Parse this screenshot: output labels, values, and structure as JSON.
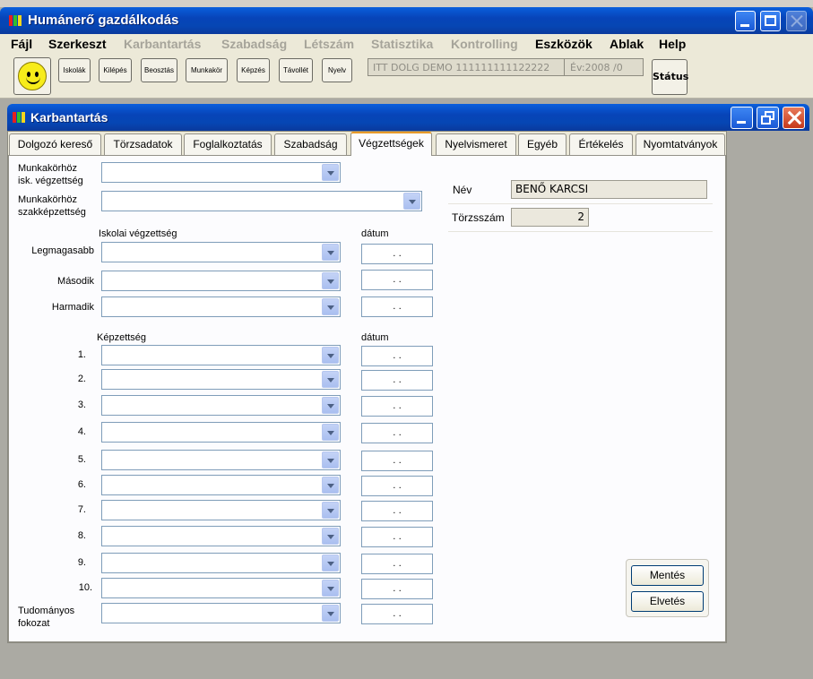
{
  "app": {
    "title": "Humánerő gazdálkodás",
    "menu": [
      {
        "label": "Fájl",
        "enabled": true
      },
      {
        "label": "Szerkeszt",
        "enabled": true
      },
      {
        "label": "Karbantartás",
        "enabled": false
      },
      {
        "label": "Szabadság",
        "enabled": false
      },
      {
        "label": "Létszám",
        "enabled": false
      },
      {
        "label": "Statisztika",
        "enabled": false
      },
      {
        "label": "Kontrolling",
        "enabled": false
      },
      {
        "label": "Eszközök",
        "enabled": true
      },
      {
        "label": "Ablak",
        "enabled": true
      },
      {
        "label": "Help",
        "enabled": true
      }
    ],
    "toolbar": {
      "buttons": [
        "Iskolák",
        "Kilépés",
        "Beosztás",
        "Munkakör",
        "Képzés",
        "Távollét",
        "Nyelv"
      ],
      "info_text": "ITT DOLG DEMO 111111111122222",
      "info_year": "Év:2008  /0",
      "status_label": "Státus"
    }
  },
  "child": {
    "title": "Karbantartás",
    "tabs": [
      "Dolgozó kereső",
      "Törzsadatok",
      "Foglalkoztatás",
      "Szabadság",
      "Végzettségek",
      "Nyelvismeret",
      "Egyéb",
      "Értékelés",
      "Nyomtatványok"
    ],
    "active_tab": "Végzettségek",
    "form": {
      "mk_isk_label": "Munkakörhöz\nisk. végzettség",
      "mk_szak_label": "Munkakörhöz\nszakképzettség",
      "school_header": "Iskolai végzettség",
      "date_header": "dátum",
      "school_rows": [
        "Legmagasabb",
        "Második",
        "Harmadik"
      ],
      "skill_header": "Képzettség",
      "skill_rows": [
        "1.",
        "2.",
        "3.",
        "4.",
        "5.",
        "6.",
        "7.",
        "8.",
        "9.",
        "10."
      ],
      "degree_label": "Tudományos\nfokozat",
      "date_placeholder": ". ."
    },
    "employee": {
      "name_label": "Név",
      "name_value": "BENŐ KARCSI",
      "id_label": "Törzsszám",
      "id_value": "2"
    },
    "buttons": {
      "save": "Mentés",
      "cancel": "Elvetés"
    }
  }
}
